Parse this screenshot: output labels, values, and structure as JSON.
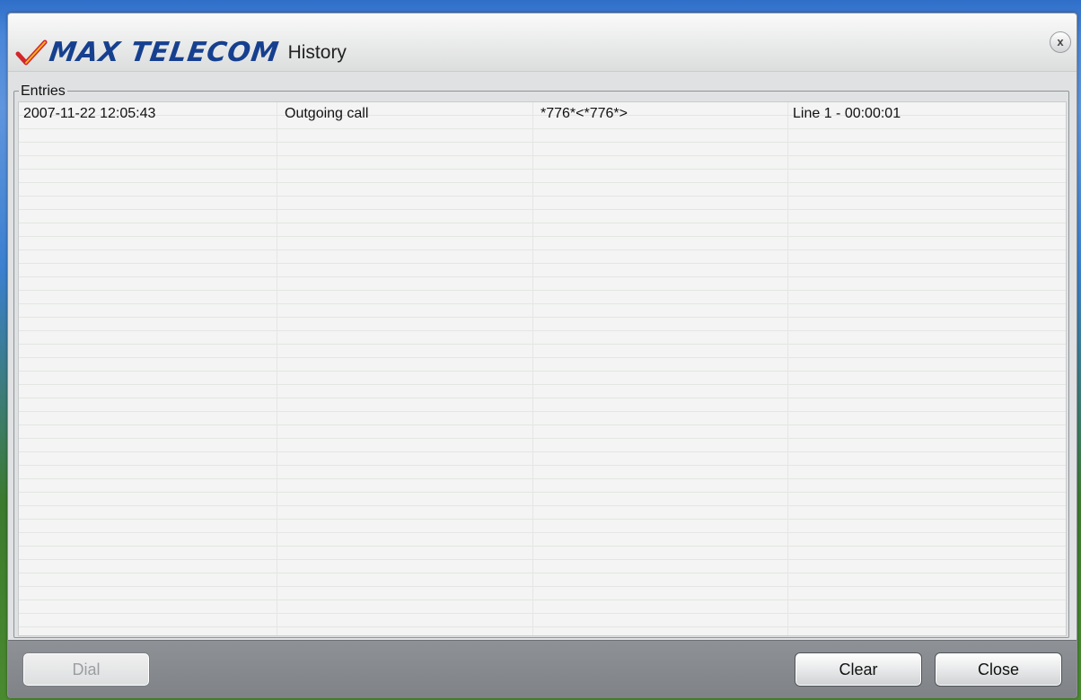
{
  "window": {
    "brand": "MAX TELECOM",
    "title": "History",
    "close_icon": "x"
  },
  "entries": {
    "label": "Entries",
    "rows": [
      {
        "datetime": "2007-11-22 12:05:43",
        "type": "Outgoing call",
        "number": "*776*<*776*>",
        "line_duration": "Line 1 - 00:00:01"
      }
    ]
  },
  "buttons": {
    "dial": "Dial",
    "clear": "Clear",
    "close": "Close"
  },
  "colors": {
    "brand": "#16408f",
    "check": "#d3262a",
    "bottombar": "#878b8f"
  }
}
